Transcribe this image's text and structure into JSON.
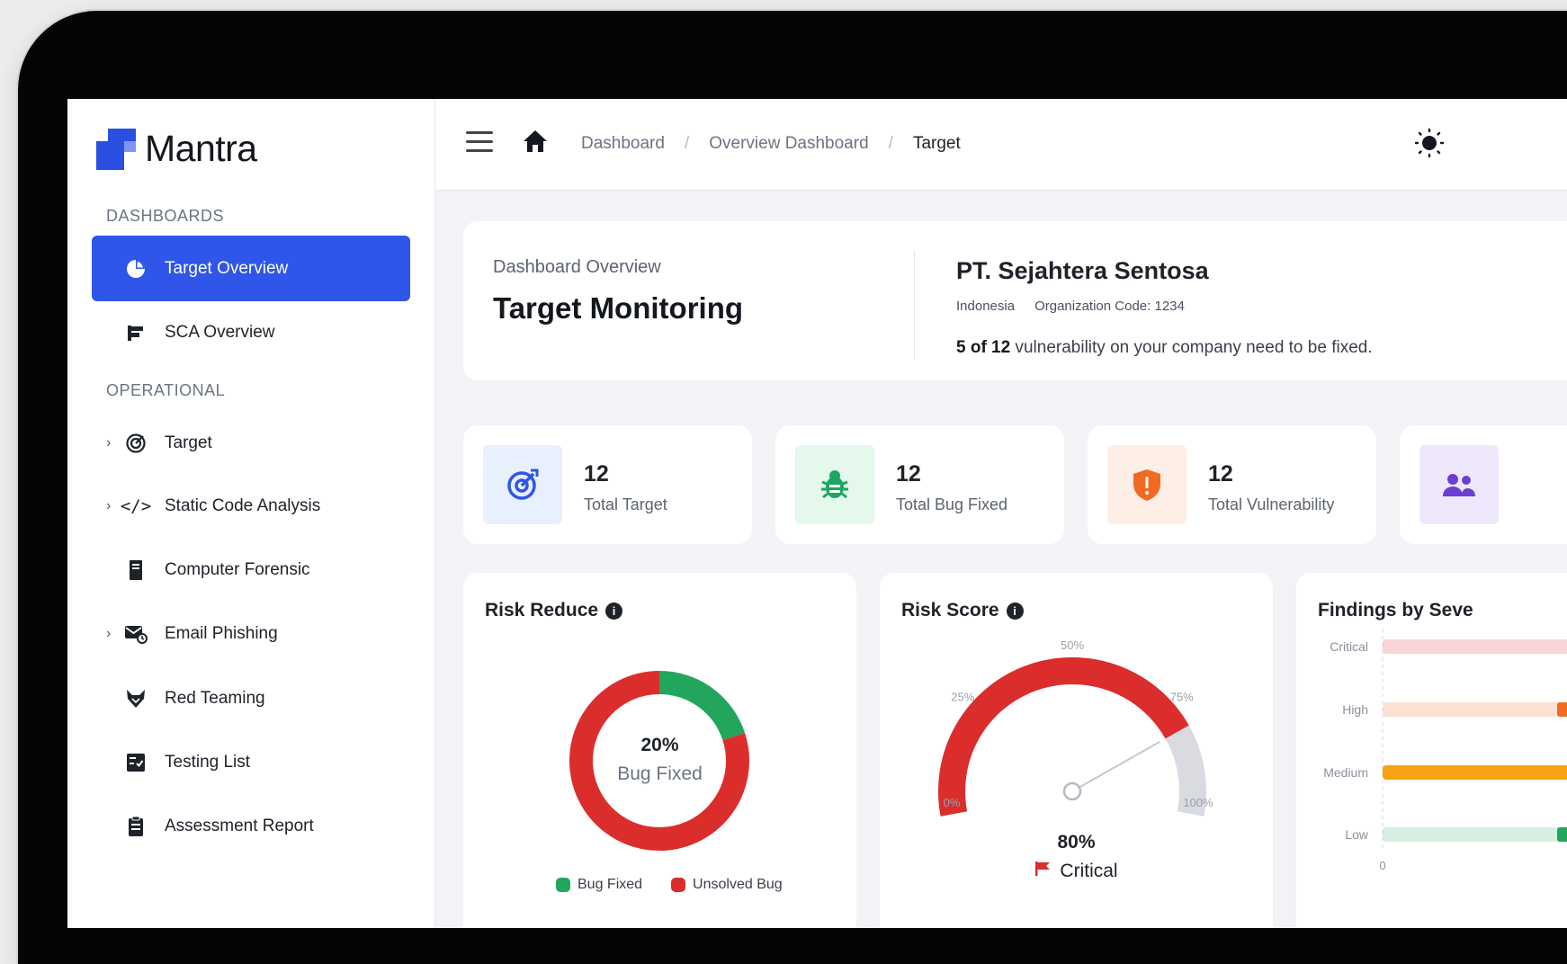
{
  "app": {
    "name": "Mantra"
  },
  "sidebar": {
    "section_dashboards": "DASHBOARDS",
    "section_operational": "OPERATIONAL",
    "items": [
      {
        "label": "Target Overview",
        "icon": "pie-chart-icon",
        "active": true
      },
      {
        "label": "SCA Overview",
        "icon": "sca-icon"
      },
      {
        "label": "Target",
        "icon": "target-icon",
        "expandable": true
      },
      {
        "label": "Static Code Analysis",
        "icon": "code-icon",
        "expandable": true
      },
      {
        "label": "Computer Forensic",
        "icon": "device-icon"
      },
      {
        "label": "Email Phishing",
        "icon": "mail-icon",
        "expandable": true
      },
      {
        "label": "Red Teaming",
        "icon": "fox-icon"
      },
      {
        "label": "Testing List",
        "icon": "checklist-icon"
      },
      {
        "label": "Assessment Report",
        "icon": "clipboard-icon"
      }
    ]
  },
  "topbar": {
    "breadcrumb": [
      "Dashboard",
      "Overview Dashboard",
      "Target"
    ],
    "separator": "/"
  },
  "overview": {
    "subtitle": "Dashboard Overview",
    "title": "Target Monitoring",
    "company": "PT. Sejahtera Sentosa",
    "country": "Indonesia",
    "org_code": "Organization Code: 1234",
    "msg_count": "5 of 12",
    "msg_text": " vulnerability on your company need to be fixed."
  },
  "stats": [
    {
      "value": "12",
      "label": "Total Target",
      "icon": "target-icon",
      "bg": "#e8effd",
      "fg": "#2f56e8"
    },
    {
      "value": "12",
      "label": "Total Bug Fixed",
      "icon": "bug-icon",
      "bg": "#e4f8ec",
      "fg": "#1aa761"
    },
    {
      "value": "12",
      "label": "Total Vulnerability",
      "icon": "shield-alert-icon",
      "bg": "#fdeee6",
      "fg": "#f26a21"
    },
    {
      "value": "",
      "label": "",
      "icon": "users-icon",
      "bg": "#efe8fc",
      "fg": "#6b3fd4"
    }
  ],
  "risk_reduce": {
    "title": "Risk Reduce",
    "center_value": "20%",
    "center_label": "Bug Fixed",
    "legend": [
      "Bug Fixed",
      "Unsolved Bug"
    ]
  },
  "risk_score": {
    "title": "Risk Score",
    "value": "80%",
    "level": "Critical",
    "ticks": [
      "0%",
      "25%",
      "50%",
      "75%",
      "100%"
    ]
  },
  "findings": {
    "title": "Findings by Seve",
    "categories": [
      "Critical",
      "High",
      "Medium",
      "Low"
    ],
    "axis_zero": "0"
  },
  "chart_data": [
    {
      "type": "pie",
      "title": "Risk Reduce",
      "categories": [
        "Bug Fixed",
        "Unsolved Bug"
      ],
      "values": [
        20,
        80
      ],
      "colors": [
        "#22a55c",
        "#dc2d2d"
      ]
    },
    {
      "type": "bar",
      "title": "Risk Score",
      "values": [
        80
      ],
      "ylim": [
        0,
        100
      ],
      "ticks": [
        "0%",
        "25%",
        "50%",
        "75%",
        "100%"
      ]
    },
    {
      "type": "bar",
      "title": "Findings by Seve",
      "categories": [
        "Critical",
        "High",
        "Medium",
        "Low"
      ],
      "colors": [
        "#f4b3b3",
        "#f26a21",
        "#f5a312",
        "#22a55c"
      ]
    }
  ],
  "colors": {
    "accent": "#2f56e8",
    "critical": "#dc2d2d",
    "success": "#22a55c",
    "warning": "#f5a312",
    "high": "#f26a21"
  }
}
